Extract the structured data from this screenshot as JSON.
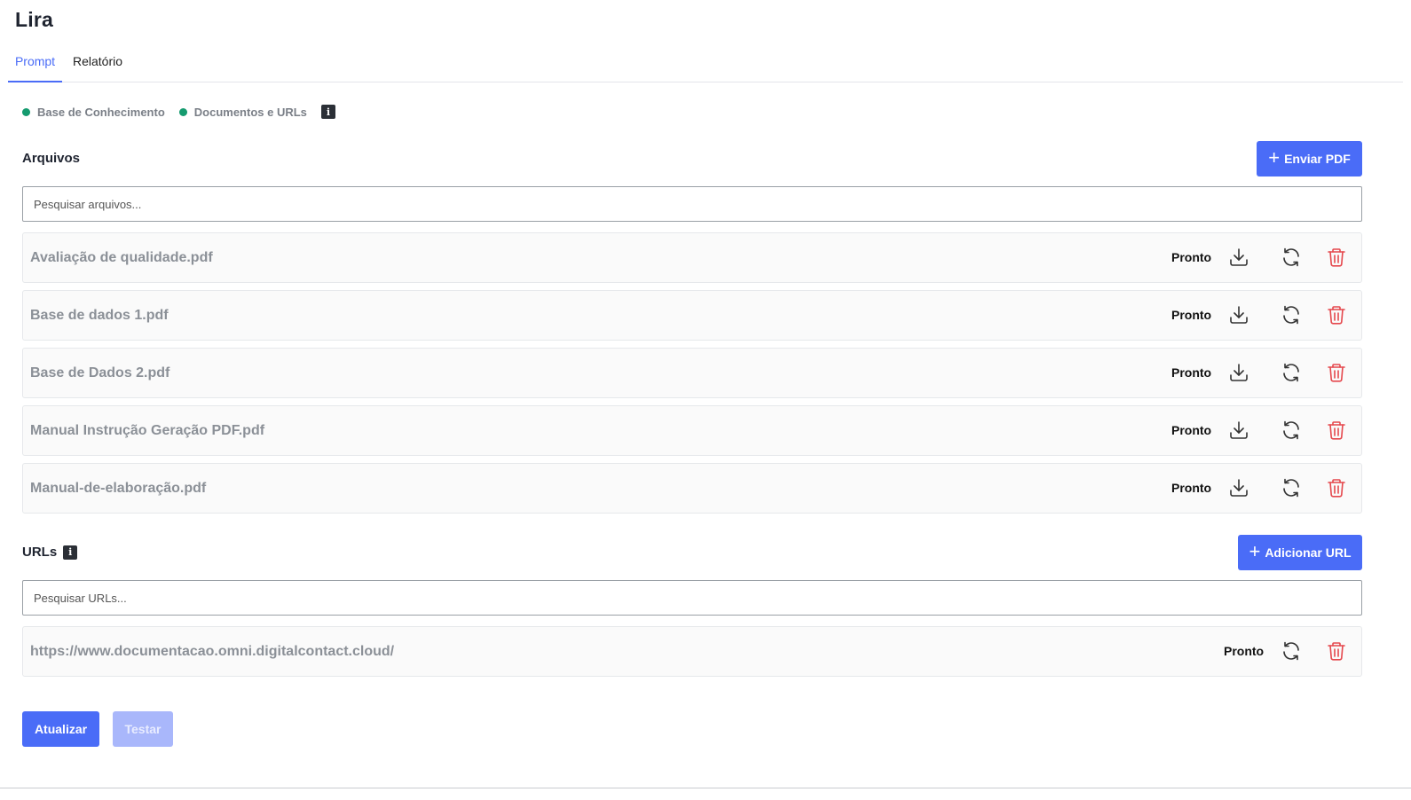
{
  "app": {
    "title": "Lira"
  },
  "tabs": [
    {
      "label": "Prompt",
      "active": true
    },
    {
      "label": "Relatório",
      "active": false
    }
  ],
  "sources": [
    {
      "label": "Base de Conhecimento",
      "status_color": "#159b6f"
    },
    {
      "label": "Documentos e URLs",
      "status_color": "#159b6f"
    }
  ],
  "files": {
    "title": "Arquivos",
    "upload_label": "Enviar PDF",
    "search_placeholder": "Pesquisar arquivos...",
    "items": [
      {
        "name": "Avaliação de qualidade.pdf",
        "status": "Pronto"
      },
      {
        "name": "Base de dados 1.pdf",
        "status": "Pronto"
      },
      {
        "name": "Base de Dados 2.pdf",
        "status": "Pronto"
      },
      {
        "name": "Manual Instrução Geração PDF.pdf",
        "status": "Pronto"
      },
      {
        "name": "Manual-de-elaboração.pdf",
        "status": "Pronto"
      }
    ]
  },
  "urls": {
    "title": "URLs",
    "add_label": "Adicionar URL",
    "search_placeholder": "Pesquisar URLs...",
    "items": [
      {
        "url": "https://www.documentacao.omni.digitalcontact.cloud/",
        "status": "Pronto"
      }
    ]
  },
  "actions": {
    "update_label": "Atualizar",
    "test_label": "Testar"
  },
  "colors": {
    "accent": "#4a6cf7",
    "delete": "#e5484d",
    "status_ok": "#159b6f"
  },
  "icons": {
    "download": "download-icon",
    "refresh": "refresh-icon",
    "delete": "trash-icon",
    "info": "info-icon",
    "add": "plus-icon"
  }
}
